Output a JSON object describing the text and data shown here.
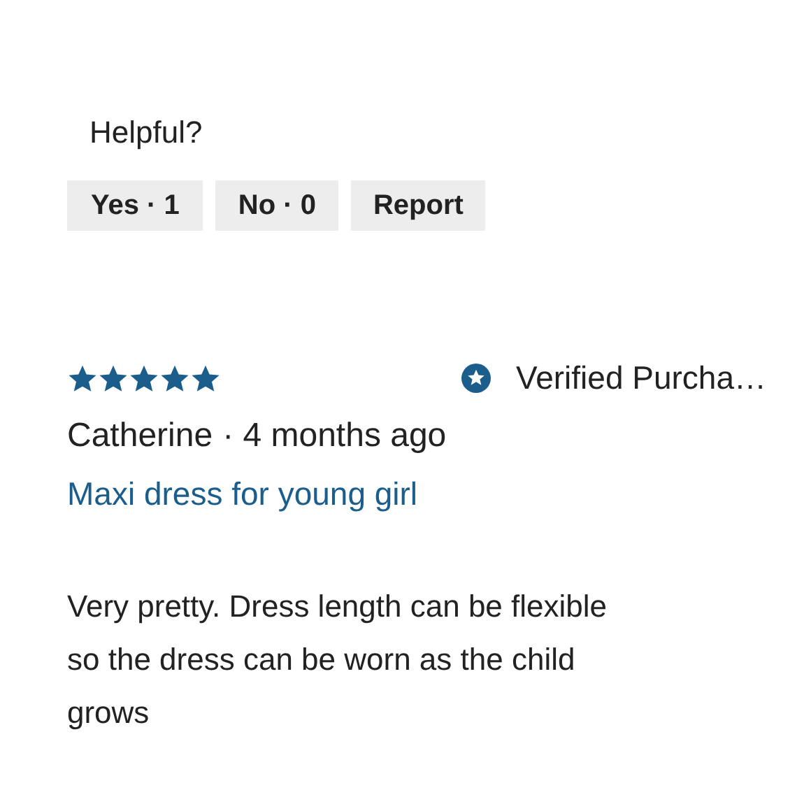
{
  "helpful": {
    "label": "Helpful?",
    "buttons": [
      "Yes · 1",
      "No · 0",
      "Report"
    ]
  },
  "review": {
    "stars": 5,
    "badge": "Verified Purcha…",
    "author": "Catherine",
    "date": "· 4 months ago",
    "title": "Maxi dress for young girl",
    "body": "Very pretty. Dress length can be flexible so the dress can be worn as the child grows"
  }
}
